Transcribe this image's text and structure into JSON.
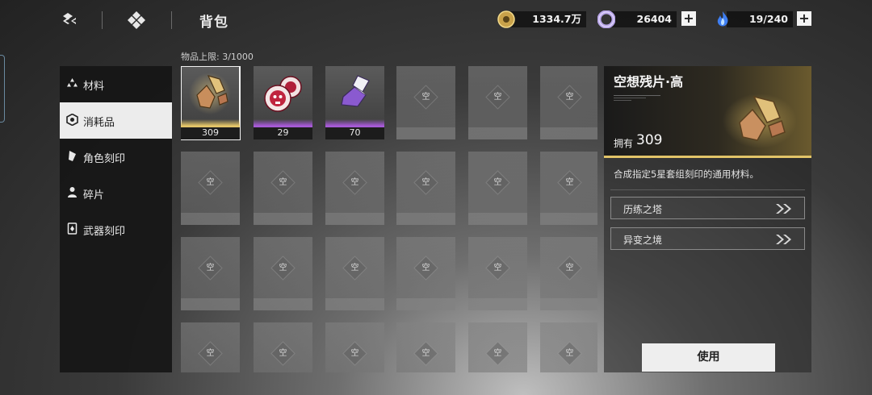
{
  "header": {
    "title": "背包",
    "resources": [
      {
        "icon": "coin-icon",
        "value": "1334.7万"
      },
      {
        "icon": "crystal-ring-icon",
        "value": "26404",
        "plus": "+"
      },
      {
        "icon": "blue-flame-icon",
        "value": "19/240",
        "plus": "+"
      }
    ]
  },
  "sidebar": {
    "items": [
      {
        "label": "材料",
        "icon": "materials-icon",
        "active": false
      },
      {
        "label": "消耗品",
        "icon": "consumables-icon",
        "active": true
      },
      {
        "label": "角色刻印",
        "icon": "character-imprint-icon",
        "active": false
      },
      {
        "label": "碎片",
        "icon": "fragment-icon",
        "active": false
      },
      {
        "label": "武器刻印",
        "icon": "weapon-imprint-icon",
        "active": false
      }
    ]
  },
  "inventory": {
    "capacity": "物品上限: 3/1000",
    "empty_label": "空",
    "items": [
      {
        "name": "空想残片·高",
        "count": "309",
        "rarity_color": "#e2c468",
        "selected": true
      },
      {
        "name": "red skull bomb",
        "count": "29",
        "rarity_color": "#a65ad6",
        "selected": false
      },
      {
        "name": "purple shard",
        "count": "70",
        "rarity_color": "#a65ad6",
        "selected": false
      }
    ]
  },
  "detail": {
    "name": "空想残片·高",
    "own_label": "拥有",
    "own_count": "309",
    "description": "合成指定5星套组刻印的通用材料。",
    "sources": [
      "历练之塔",
      "异变之境"
    ],
    "use_button": "使用"
  },
  "colors": {
    "gold": "#e2c468",
    "purple": "#a65ad6"
  }
}
